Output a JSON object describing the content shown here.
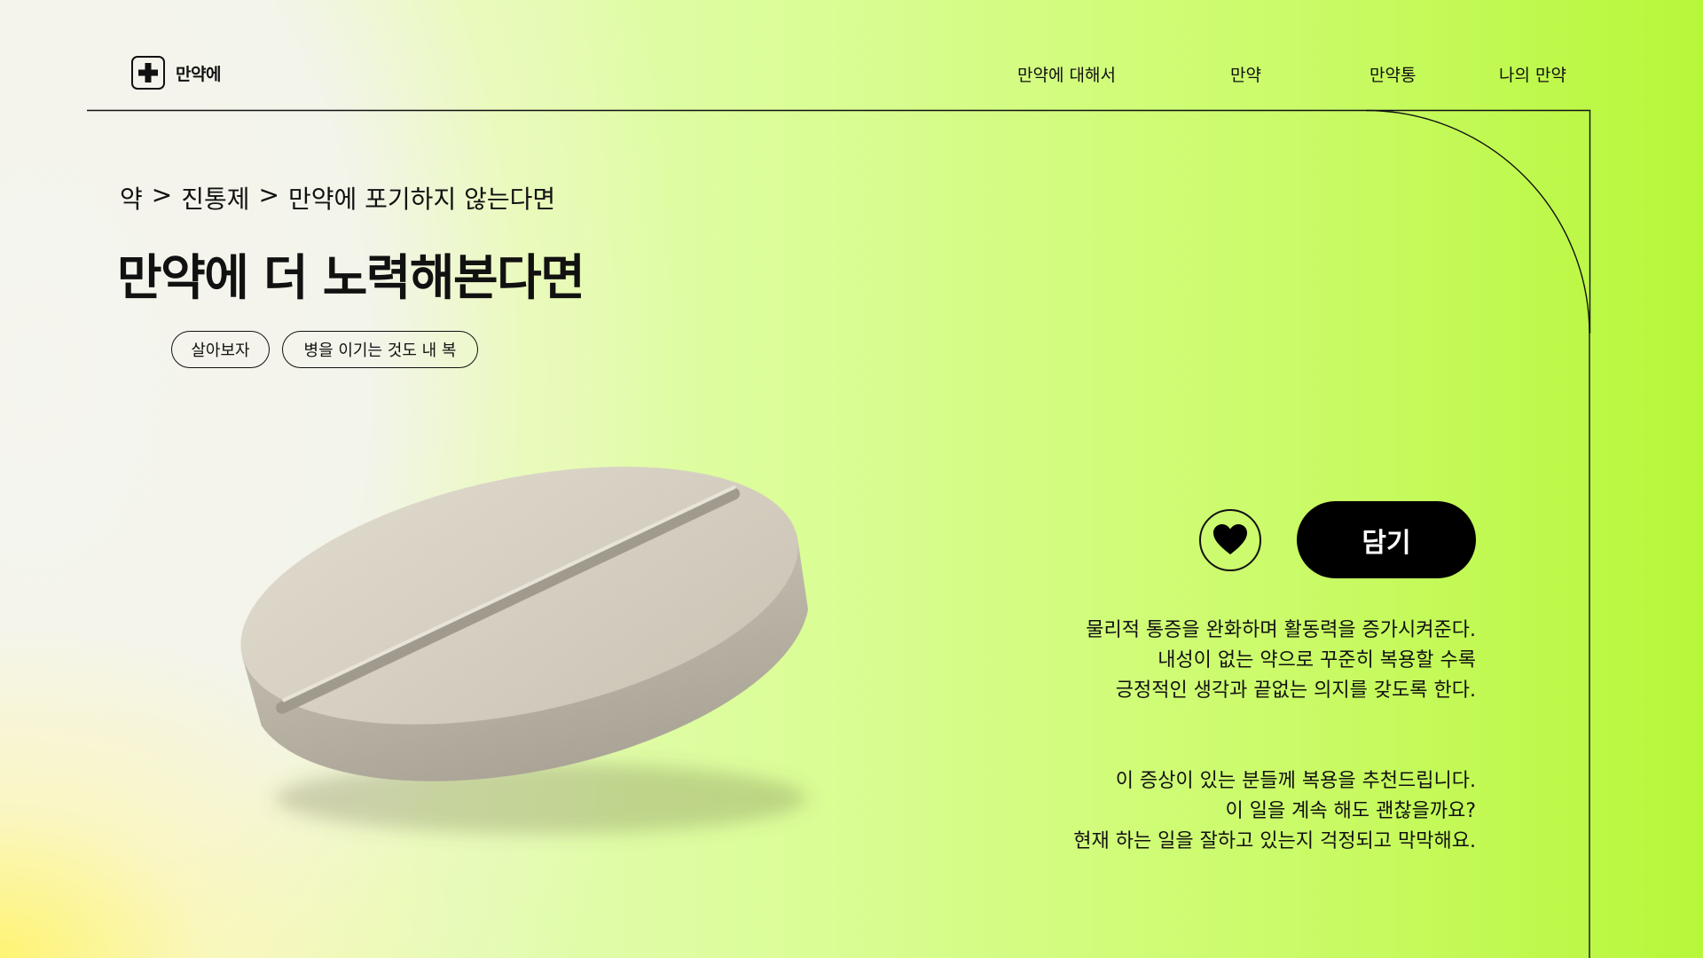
{
  "header": {
    "logo_text": "만약에",
    "nav": [
      "만약에 대해서",
      "만약",
      "만약통",
      "나의 만약"
    ]
  },
  "breadcrumb": {
    "items": [
      "약",
      "진통제",
      "만약에 포기하지 않는다면"
    ],
    "separator": ">"
  },
  "title": "만약에 더 노력해본다면",
  "tags": [
    "살아보자",
    "병을 이기는 것도 내 복"
  ],
  "actions": {
    "like_icon": "heart-icon",
    "cart_label": "담기"
  },
  "description": {
    "paragraph1": [
      "물리적 통증을 완화하며 활동력을 증가시켜준다.",
      "내성이 없는 약으로 꾸준히 복용할 수록",
      "긍정적인 생각과 끝없는 의지를 갖도록 한다."
    ],
    "paragraph2": [
      "이 증상이 있는 분들께 복용을 추천드립니다.",
      "이 일을 계속 해도 괜찮을까요?",
      "현재 하는 일을 잘하고 있는지 걱정되고 막막해요."
    ]
  },
  "colors": {
    "accent_green": "#c6fb5a",
    "button_black": "#000000",
    "pill_beige": "#d8d1c2"
  }
}
